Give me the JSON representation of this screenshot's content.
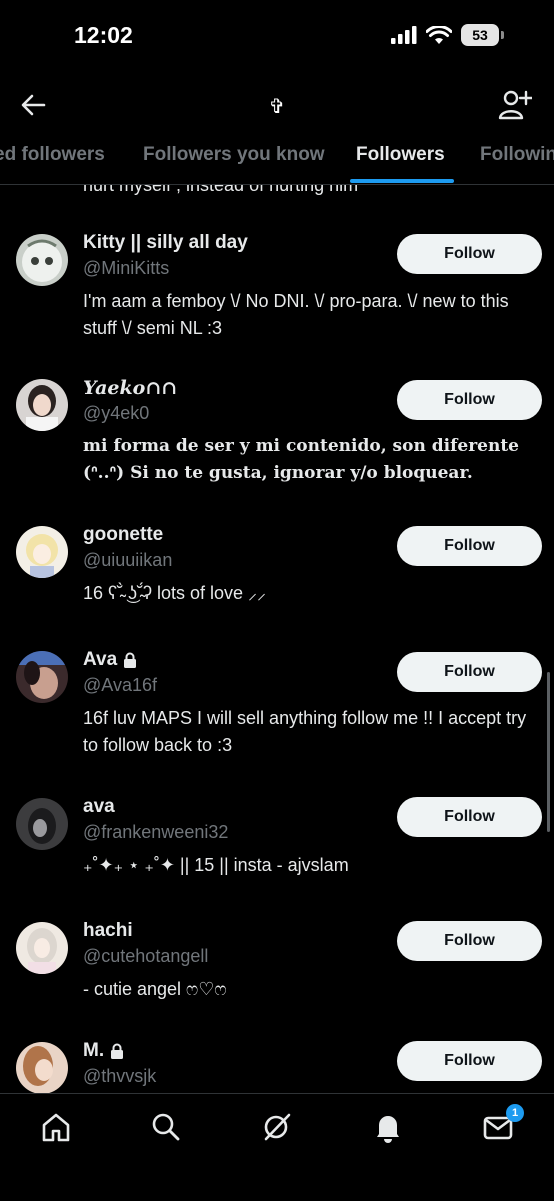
{
  "status_bar": {
    "time": "12:02",
    "battery": "53"
  },
  "header": {
    "title": "✞"
  },
  "tabs": [
    {
      "label": "ed followers"
    },
    {
      "label": "Followers you know"
    },
    {
      "label": "Followers"
    },
    {
      "label": "Followin"
    }
  ],
  "active_tab": "Followers",
  "list": {
    "cut_text": "hurt myself , instead of hurting him",
    "users": [
      {
        "name": "Kitty || silly all day",
        "handle": "@MiniKitts",
        "bio": "I'm aam a femboy \\/ No DNI. \\/ pro-para. \\/ new to this stuff \\/ semi NL :3",
        "button": "Follow",
        "locked": false
      },
      {
        "name": "Yaeko∩∩",
        "handle": "@y4ek0",
        "bio": "mi forma de ser y mi contenido, son diferente (ᐢ..ᐢ) Si no te gusta, ignorar y/o bloquear.",
        "button": "Follow",
        "locked": false
      },
      {
        "name": "goonette",
        "handle": "@uiuuiikan",
        "bio": "16 ʕ˘̴̀ ͜ʖ˘̴́ʔ lots of love ⸝⸝",
        "button": "Follow",
        "locked": false
      },
      {
        "name": "Ava",
        "handle": "@Ava16f",
        "bio": "16f luv MAPS I will sell anything follow me !! I accept try to follow back to :3",
        "button": "Follow",
        "locked": true
      },
      {
        "name": "ava",
        "handle": "@frankenweeni32",
        "bio": "₊˚✦₊ ⋆ ₊˚✦ || 15 || insta - ajvslam",
        "button": "Follow",
        "locked": false
      },
      {
        "name": "hachi",
        "handle": "@cutehotangell",
        "bio": "- cutie angel ෆ♡ෆ",
        "button": "Follow",
        "locked": false
      },
      {
        "name": "M.",
        "handle": "@thvvsjk",
        "bio": "",
        "button": "Follow",
        "locked": true
      }
    ]
  },
  "bottom_nav": {
    "items": [
      "home",
      "search",
      "grok",
      "notifications",
      "messages"
    ],
    "messages_badge": "1"
  },
  "colors": {
    "background": "#000000",
    "accent": "#1d9bf0",
    "muted": "#71767b",
    "button": "#eff3f4"
  }
}
